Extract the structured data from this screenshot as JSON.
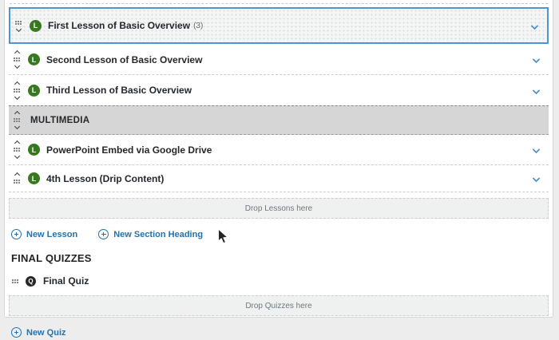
{
  "colors": {
    "accent_blue": "#2273ae",
    "selected_row_border": "#4f94d4",
    "lesson_green": "#37791f",
    "quiz_black": "#23282d",
    "section_gray": "#d6d6d7"
  },
  "course_outline": {
    "rows": [
      {
        "type": "lesson",
        "icon": "L",
        "label": "First Lesson of Basic Overview",
        "count": "(3)",
        "selected": true
      },
      {
        "type": "lesson",
        "icon": "L",
        "label": "Second Lesson of Basic Overview"
      },
      {
        "type": "lesson",
        "icon": "L",
        "label": "Third Lesson of Basic Overview"
      },
      {
        "type": "section-heading",
        "label": "MULTIMEDIA"
      },
      {
        "type": "lesson",
        "icon": "L",
        "label": "PowerPoint Embed via Google Drive"
      },
      {
        "type": "lesson",
        "icon": "L",
        "label": "4th Lesson (Drip Content)"
      }
    ],
    "drop_zone_label": "Drop Lessons here",
    "actions": [
      {
        "label": "New Lesson"
      },
      {
        "label": "New Section Heading"
      }
    ]
  },
  "final_quizzes": {
    "heading": "FINAL QUIZZES",
    "rows": [
      {
        "type": "quiz",
        "icon": "Q",
        "label": "Final Quiz"
      }
    ],
    "drop_zone_label": "Drop Quizzes here",
    "actions": [
      {
        "label": "New Quiz"
      }
    ]
  }
}
